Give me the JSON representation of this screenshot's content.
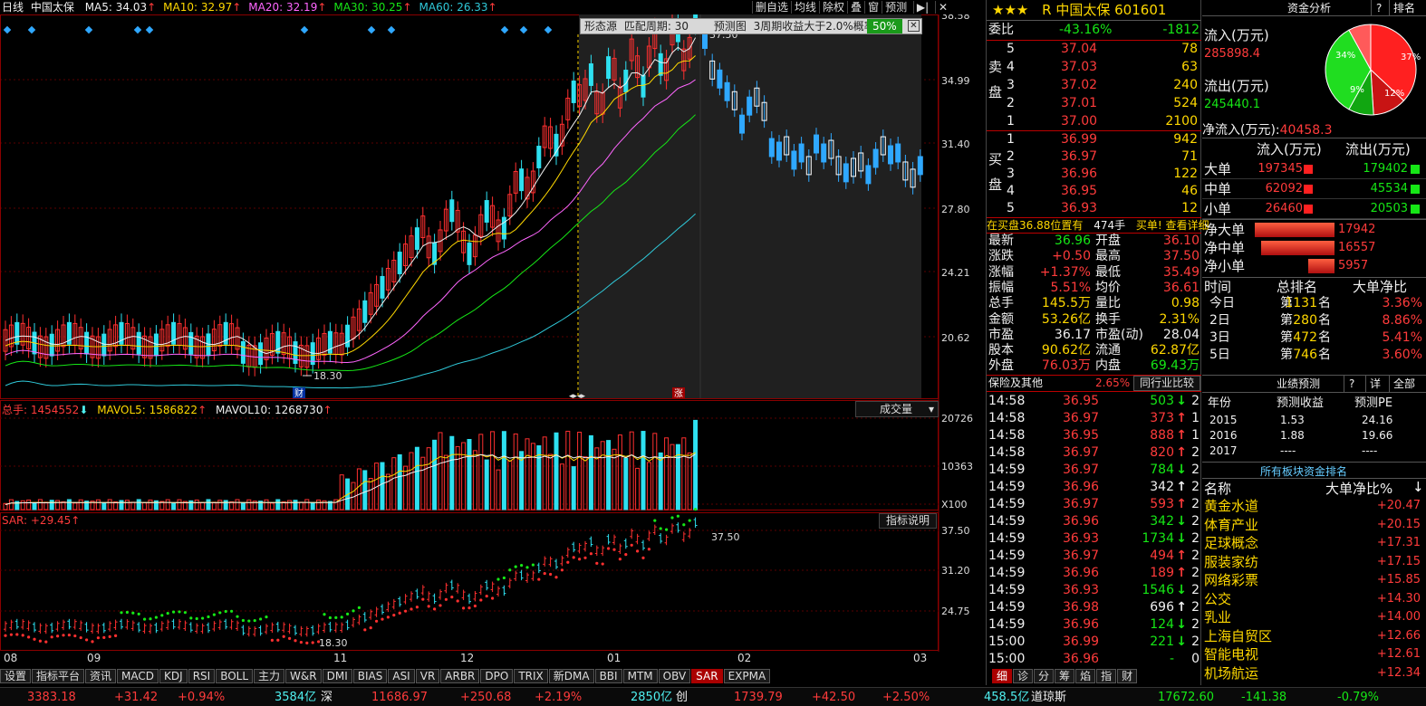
{
  "chart": {
    "period": "日线",
    "stock_name": "中国太保",
    "ma_items": [
      {
        "label": "MA5: 34.03",
        "color": "#f0f0f0"
      },
      {
        "label": "MA10: 32.97",
        "color": "#ffd800"
      },
      {
        "label": "MA20: 32.19",
        "color": "#ff66ff"
      },
      {
        "label": "MA30: 30.25",
        "color": "#16e716"
      },
      {
        "label": "MA60: 26.33",
        "color": "#2fc8d8"
      }
    ],
    "toolbar": [
      "删自选",
      "均线",
      "除权",
      "叠",
      "窗",
      "预测"
    ],
    "price_ticks": [
      "38.58",
      "34.99",
      "31.40",
      "27.80",
      "24.21",
      "20.62"
    ],
    "low_label": "18.30",
    "high_label": "37.50",
    "markers": [
      "财",
      "涨"
    ],
    "overlay": {
      "label": "形态源",
      "match": "匹配周期:",
      "period_val": "30",
      "forecast": "预测图",
      "desc": "3周期收益大于2.0%概率",
      "pct": "50%"
    },
    "vol_legend": {
      "total": "总手: 1454552",
      "mavol5": "MAVOL5: 1586822",
      "mavol10": "MAVOL10: 1268730"
    },
    "vol_select": "成交量",
    "vol_ticks": [
      "20726",
      "10363",
      "X100"
    ],
    "sar_legend": "SAR: +29.45",
    "indicator_btn": "指标说明",
    "sar_ticks": [
      "37.50",
      "31.20",
      "24.75"
    ],
    "sar_high": "37.50",
    "sar_low": "18.30",
    "months": [
      "08",
      "09",
      "11",
      "12",
      "01",
      "02",
      "03"
    ]
  },
  "bottom_tabs": [
    "设置",
    "指标平台",
    "资讯",
    "MACD",
    "KDJ",
    "RSI",
    "BOLL",
    "主力",
    "W&R",
    "DMI",
    "BIAS",
    "ASI",
    "VR",
    "ARBR",
    "DPO",
    "TRIX",
    "新DMA",
    "BBI",
    "MTM",
    "OBV",
    "SAR",
    "EXPMA"
  ],
  "active_tab": "SAR",
  "status": {
    "sh_idx": "3383.18",
    "sh_chg": "+31.42",
    "sh_pct": "+0.94%",
    "sh_amt": "3584亿",
    "sz": "深",
    "sz_idx": "11686.97",
    "sz_chg": "+250.68",
    "sz_pct": "+2.19%",
    "cy_amt": "2850亿",
    "cy": "创",
    "cy_idx": "1739.79",
    "cy_chg": "+42.50",
    "cy_pct": "+2.50%",
    "dj_amt": "458.5亿",
    "dj": "道琼斯",
    "dj_idx": "17672.60",
    "dj_chg": "-141.38",
    "dj_pct": "-0.79%"
  },
  "quote": {
    "stars": "★★★",
    "r": "R",
    "name": "中国太保",
    "code": "601601",
    "weibi_label": "委比",
    "weibi_pct": "-43.16%",
    "weibi_val": "-1812",
    "sell_label": "卖盘",
    "buy_label": "买盘",
    "asks": [
      {
        "n": "5",
        "p": "37.04",
        "v": "78"
      },
      {
        "n": "4",
        "p": "37.03",
        "v": "63"
      },
      {
        "n": "3",
        "p": "37.02",
        "v": "240"
      },
      {
        "n": "2",
        "p": "37.01",
        "v": "524"
      },
      {
        "n": "1",
        "p": "37.00",
        "v": "2100"
      }
    ],
    "bids": [
      {
        "n": "1",
        "p": "36.99",
        "v": "942"
      },
      {
        "n": "2",
        "p": "36.97",
        "v": "71"
      },
      {
        "n": "3",
        "p": "36.96",
        "v": "122"
      },
      {
        "n": "4",
        "p": "36.95",
        "v": "46"
      },
      {
        "n": "5",
        "p": "36.93",
        "v": "12"
      }
    ],
    "notice": "在买盘36.88位置有",
    "notice_v": "474手",
    "notice_tail": "买单! 查看详细",
    "stats_left": [
      [
        "最新",
        "36.96"
      ],
      [
        "涨跌",
        "+0.50"
      ],
      [
        "涨幅",
        "+1.37%"
      ],
      [
        "振幅",
        "5.51%"
      ],
      [
        "总手",
        "145.5万"
      ],
      [
        "金额",
        "53.26亿"
      ],
      [
        "市盈",
        "36.17"
      ],
      [
        "股本",
        "90.62亿"
      ],
      [
        "外盘",
        "76.03万"
      ]
    ],
    "stats_right": [
      [
        "开盘",
        "36.10"
      ],
      [
        "最高",
        "37.50"
      ],
      [
        "最低",
        "35.49"
      ],
      [
        "均价",
        "36.61"
      ],
      [
        "量比",
        "0.98"
      ],
      [
        "换手",
        "2.31%"
      ],
      [
        "市盈(动)",
        "28.04"
      ],
      [
        "流通",
        "62.87亿"
      ],
      [
        "内盘",
        "69.43万"
      ]
    ],
    "sector": "保险及其他",
    "sector_pct": "2.65%",
    "sector_btn": "同行业比较",
    "ticks": [
      {
        "t": "14:58",
        "p": "36.95",
        "v": "503",
        "d": "down",
        "c": "2"
      },
      {
        "t": "14:58",
        "p": "36.97",
        "v": "373",
        "d": "up",
        "c": "1"
      },
      {
        "t": "14:58",
        "p": "36.95",
        "v": "888",
        "d": "up",
        "c": "1"
      },
      {
        "t": "14:58",
        "p": "36.97",
        "v": "820",
        "d": "up",
        "c": "2"
      },
      {
        "t": "14:59",
        "p": "36.97",
        "v": "784",
        "d": "down",
        "c": "2"
      },
      {
        "t": "14:59",
        "p": "36.96",
        "v": "342",
        "d": "flat",
        "c": "2"
      },
      {
        "t": "14:59",
        "p": "36.97",
        "v": "593",
        "d": "up",
        "c": "2"
      },
      {
        "t": "14:59",
        "p": "36.96",
        "v": "342",
        "d": "down",
        "c": "2"
      },
      {
        "t": "14:59",
        "p": "36.93",
        "v": "1734",
        "d": "down",
        "c": "2"
      },
      {
        "t": "14:59",
        "p": "36.97",
        "v": "494",
        "d": "up",
        "c": "2"
      },
      {
        "t": "14:59",
        "p": "36.96",
        "v": "189",
        "d": "up",
        "c": "2"
      },
      {
        "t": "14:59",
        "p": "36.93",
        "v": "1546",
        "d": "down",
        "c": "2"
      },
      {
        "t": "14:59",
        "p": "36.98",
        "v": "696",
        "d": "flat",
        "c": "2"
      },
      {
        "t": "14:59",
        "p": "36.96",
        "v": "124",
        "d": "down",
        "c": "2"
      },
      {
        "t": "15:00",
        "p": "36.99",
        "v": "221",
        "d": "down",
        "c": "2"
      },
      {
        "t": "15:00",
        "p": "36.96",
        "v": "-",
        "d": "none",
        "c": "0"
      }
    ],
    "bottom_tabs": [
      "细",
      "诊",
      "分",
      "筹",
      "焰",
      "指",
      "财"
    ]
  },
  "fund": {
    "title": "资金分析",
    "help": "?",
    "rank": "排名",
    "inflow_label": "流入(万元)",
    "inflow": "285898.4",
    "outflow_label": "流出(万元)",
    "outflow": "245440.1",
    "net_label": "净流入(万元):",
    "net": "40458.3",
    "pie": [
      {
        "label": "37%",
        "value": 37,
        "color": "#ff2020"
      },
      {
        "label": "12%",
        "value": 12,
        "color": "#c81414"
      },
      {
        "label": "9%",
        "value": 9,
        "color": "#11a611"
      },
      {
        "label": "34%",
        "value": 34,
        "color": "#20dd20"
      }
    ],
    "pie_rest": {
      "value": 8,
      "color": "#ff5a5a"
    },
    "col_in": "流入(万元)",
    "col_out": "流出(万元)",
    "rows": [
      {
        "label": "大单",
        "in": "197345",
        "out": "179402"
      },
      {
        "label": "中单",
        "in": "62092",
        "out": "45534"
      },
      {
        "label": "小单",
        "in": "26460",
        "out": "20503"
      }
    ],
    "net_rows": [
      {
        "label": "净大单",
        "v": "17942",
        "pct": 100
      },
      {
        "label": "净中单",
        "v": "16557",
        "pct": 92
      },
      {
        "label": "净小单",
        "v": "5957",
        "pct": 33
      }
    ],
    "rank_header": [
      "时间",
      "总排名",
      "大单净比"
    ],
    "rank_rows": [
      {
        "t": "今日",
        "pre": "第",
        "n": "1131",
        "post": "名",
        "pct": "3.36%"
      },
      {
        "t": "2日",
        "pre": "第",
        "n": "280",
        "post": "名",
        "pct": "8.86%"
      },
      {
        "t": "3日",
        "pre": "第",
        "n": "472",
        "post": "名",
        "pct": "5.41%"
      },
      {
        "t": "5日",
        "pre": "第",
        "n": "746",
        "post": "名",
        "pct": "3.60%"
      }
    ],
    "forecast_title": "业绩预测",
    "forecast_q": "?",
    "forecast_xiang": "详",
    "forecast_all": "全部",
    "forecast_header": [
      "年份",
      "预测收益",
      "预测PE"
    ],
    "forecast_rows": [
      {
        "y": "2015",
        "e": "1.53",
        "pe": "24.16"
      },
      {
        "y": "2016",
        "e": "1.88",
        "pe": "19.66"
      },
      {
        "y": "2017",
        "e": "----",
        "pe": "----"
      }
    ],
    "sector_title": "所有板块资金排名",
    "sector_header": [
      "名称",
      "大单净比%"
    ],
    "sectors": [
      {
        "n": "黄金水道",
        "v": "+20.47"
      },
      {
        "n": "体育产业",
        "v": "+20.15"
      },
      {
        "n": "足球概念",
        "v": "+17.31"
      },
      {
        "n": "服装家纺",
        "v": "+17.15"
      },
      {
        "n": "网络彩票",
        "v": "+15.85"
      },
      {
        "n": "公交",
        "v": "+14.30"
      },
      {
        "n": "乳业",
        "v": "+14.00"
      },
      {
        "n": "上海自贸区",
        "v": "+12.66"
      },
      {
        "n": "智能电视",
        "v": "+12.61"
      },
      {
        "n": "机场航运",
        "v": "+12.34"
      }
    ]
  }
}
